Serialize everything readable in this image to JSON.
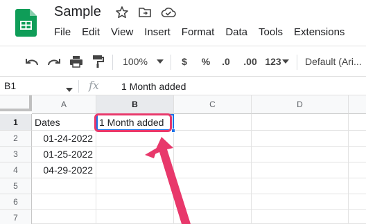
{
  "app": {
    "title": "Sample",
    "icons": [
      "sheets-logo",
      "star-icon",
      "move-to-folder-icon",
      "cloud-saved-icon"
    ],
    "colors": {
      "brand": "#0f9d58",
      "selection": "#1a73e8",
      "annotation": "#e8386b"
    }
  },
  "menu": [
    "File",
    "Edit",
    "View",
    "Insert",
    "Format",
    "Data",
    "Tools",
    "Extensions"
  ],
  "toolbar": {
    "zoom": "100%",
    "currency": "$",
    "percent": "%",
    "decrease_decimal": ".0",
    "increase_decimal": ".00",
    "number_format": "123",
    "font": "Default (Ari..."
  },
  "formula_bar": {
    "cell_ref": "B1",
    "fx": "fx",
    "value": "1 Month added"
  },
  "grid": {
    "columns": [
      "A",
      "B",
      "C",
      "D"
    ],
    "selected_column": "B",
    "rows": [
      {
        "num": "1",
        "a": "Dates",
        "b": "1 Month added"
      },
      {
        "num": "2",
        "a": "01-24-2022",
        "b": ""
      },
      {
        "num": "3",
        "a": "01-25-2022",
        "b": ""
      },
      {
        "num": "4",
        "a": "04-29-2022",
        "b": ""
      },
      {
        "num": "5",
        "a": "",
        "b": ""
      },
      {
        "num": "6",
        "a": "",
        "b": ""
      },
      {
        "num": "7",
        "a": "",
        "b": ""
      }
    ],
    "selected_row": "1"
  }
}
